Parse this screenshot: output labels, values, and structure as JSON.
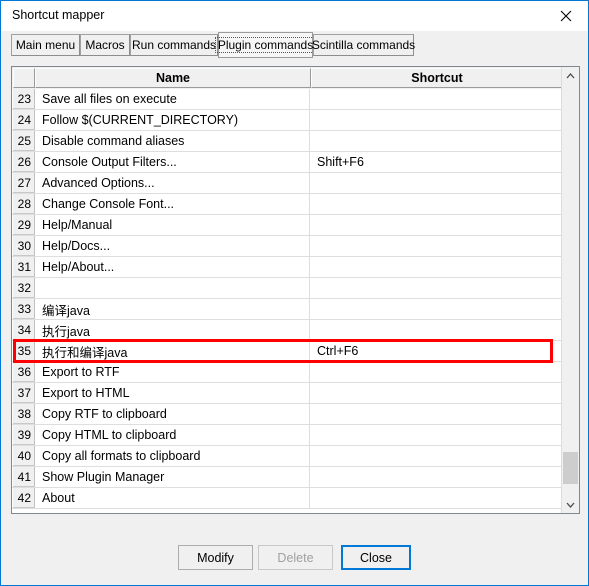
{
  "window": {
    "title": "Shortcut mapper",
    "close_icon": "close-icon"
  },
  "tabs": [
    {
      "label": "Main menu",
      "selected": false
    },
    {
      "label": "Macros",
      "selected": false
    },
    {
      "label": "Run commands",
      "selected": false
    },
    {
      "label": "Plugin commands",
      "selected": true
    },
    {
      "label": "Scintilla commands",
      "selected": false
    }
  ],
  "list": {
    "columns": {
      "num": "",
      "name": "Name",
      "shortcut": "Shortcut"
    },
    "rows": [
      {
        "num": "23",
        "name": "Save all files on execute",
        "shortcut": ""
      },
      {
        "num": "24",
        "name": "Follow $(CURRENT_DIRECTORY)",
        "shortcut": ""
      },
      {
        "num": "25",
        "name": "Disable command aliases",
        "shortcut": ""
      },
      {
        "num": "26",
        "name": "Console Output Filters...",
        "shortcut": "Shift+F6"
      },
      {
        "num": "27",
        "name": "Advanced Options...",
        "shortcut": ""
      },
      {
        "num": "28",
        "name": "Change Console Font...",
        "shortcut": ""
      },
      {
        "num": "29",
        "name": "Help/Manual",
        "shortcut": ""
      },
      {
        "num": "30",
        "name": "Help/Docs...",
        "shortcut": ""
      },
      {
        "num": "31",
        "name": "Help/About...",
        "shortcut": ""
      },
      {
        "num": "32",
        "name": "",
        "shortcut": ""
      },
      {
        "num": "33",
        "name": "编译java",
        "shortcut": ""
      },
      {
        "num": "34",
        "name": "执行java",
        "shortcut": ""
      },
      {
        "num": "35",
        "name": "执行和编译java",
        "shortcut": "Ctrl+F6"
      },
      {
        "num": "36",
        "name": "Export to RTF",
        "shortcut": ""
      },
      {
        "num": "37",
        "name": "Export to HTML",
        "shortcut": ""
      },
      {
        "num": "38",
        "name": "Copy RTF to clipboard",
        "shortcut": ""
      },
      {
        "num": "39",
        "name": "Copy HTML to clipboard",
        "shortcut": ""
      },
      {
        "num": "40",
        "name": "Copy all formats to clipboard",
        "shortcut": ""
      },
      {
        "num": "41",
        "name": "Show Plugin Manager",
        "shortcut": ""
      },
      {
        "num": "42",
        "name": "About",
        "shortcut": ""
      }
    ],
    "highlight_row_num": "35",
    "highlight_color": "#ff0000",
    "scrollbar": {
      "up_icon": "chevron-up-icon",
      "down_icon": "chevron-down-icon"
    }
  },
  "buttons": {
    "modify": "Modify",
    "delete": "Delete",
    "close": "Close"
  }
}
